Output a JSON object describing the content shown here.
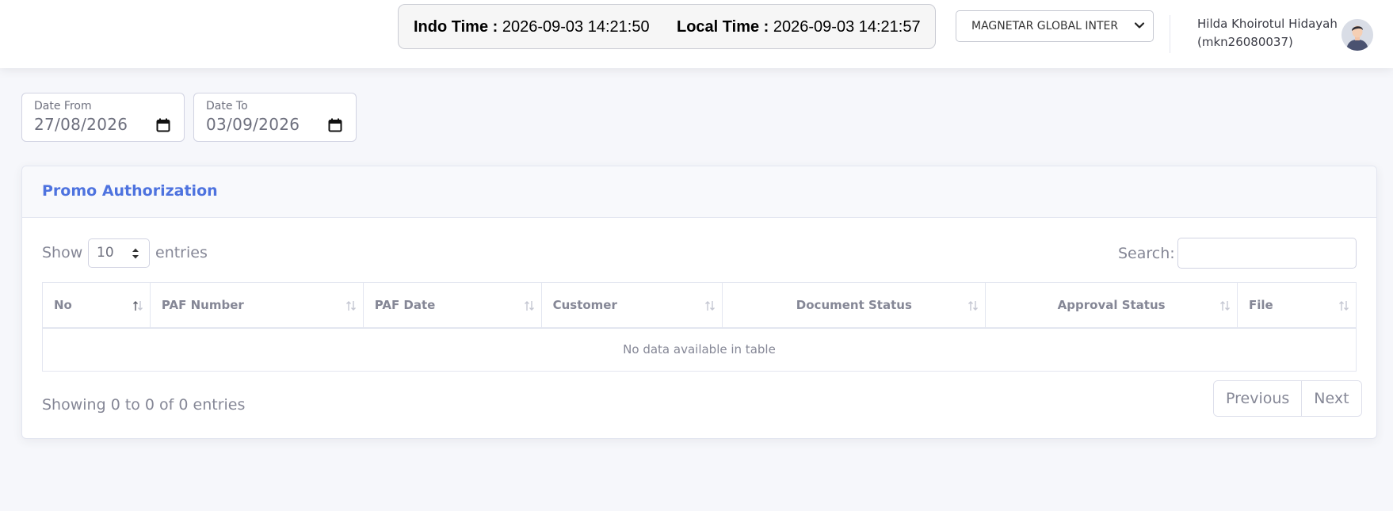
{
  "header": {
    "indo_time_label": "Indo Time :",
    "indo_time_value": "2026-09-03 14:21:50",
    "local_time_label": "Local Time :",
    "local_time_value": "2026-09-03 14:21:57",
    "company_selected": "MAGNETAR GLOBAL INTER",
    "user_name": "Hilda Khoirotul Hidayah",
    "user_id": "(mkn26080037)"
  },
  "filters": {
    "date_from_label": "Date From",
    "date_from_value": "27/08/2026",
    "date_to_label": "Date To",
    "date_to_value": "03/09/2026"
  },
  "card": {
    "title": "Promo Authorization",
    "show_label": "Show",
    "entries_value": "10",
    "entries_label": "entries",
    "search_label": "Search:",
    "search_value": "",
    "columns": [
      "No",
      "PAF Number",
      "PAF Date",
      "Customer",
      "Document Status",
      "Approval Status",
      "File"
    ],
    "empty_message": "No data available in table",
    "info": "Showing 0 to 0 of 0 entries",
    "prev_label": "Previous",
    "next_label": "Next"
  },
  "colors": {
    "accent": "#4e73df",
    "background": "#f6f7fb",
    "muted_text": "#858796"
  },
  "icons": {
    "sort": "sort-icon",
    "calendar": "calendar-icon",
    "dropdown": "chevron-down-icon",
    "avatar": "user-avatar"
  }
}
